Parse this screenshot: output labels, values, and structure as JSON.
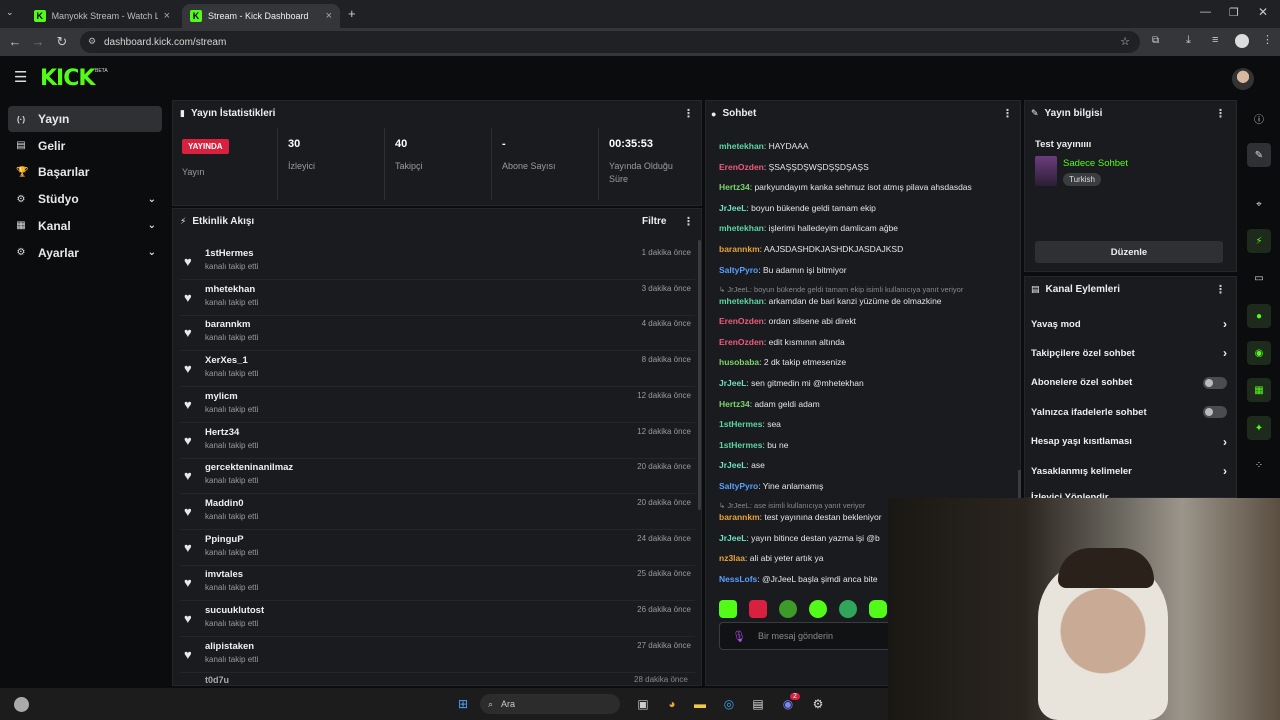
{
  "browser": {
    "tabs": [
      {
        "title": "Manyokk Stream - Watch Live o",
        "active": false
      },
      {
        "title": "Stream - Kick Dashboard",
        "active": true
      }
    ],
    "url": "dashboard.kick.com/stream"
  },
  "app": {
    "logo": "KICK",
    "beta": "BETA",
    "accent": "#53fc18"
  },
  "sidebar": {
    "items": [
      {
        "label": "Yayın",
        "icon": "broadcast-icon",
        "active": true,
        "expandable": false
      },
      {
        "label": "Gelir",
        "icon": "revenue-icon",
        "active": false,
        "expandable": false
      },
      {
        "label": "Başarılar",
        "icon": "trophy-icon",
        "active": false,
        "expandable": false
      },
      {
        "label": "Stüdyo",
        "icon": "studio-icon",
        "active": false,
        "expandable": true
      },
      {
        "label": "Kanal",
        "icon": "channel-icon",
        "active": false,
        "expandable": true
      },
      {
        "label": "Ayarlar",
        "icon": "gear-icon",
        "active": false,
        "expandable": true
      }
    ]
  },
  "stats": {
    "title": "Yayın İstatistikleri",
    "live_badge": "YAYINDA",
    "live_label": "Yayın",
    "cols": [
      {
        "value": "30",
        "label": "İzleyici"
      },
      {
        "value": "40",
        "label": "Takipçi"
      },
      {
        "value": "-",
        "label": "Abone Sayısı"
      },
      {
        "value": "00:35:53",
        "label": "Yayında Olduğu Süre"
      }
    ]
  },
  "activity": {
    "title": "Etkinlik Akışı",
    "filter": "Filtre",
    "items": [
      {
        "user": "1stHermes",
        "sub": "kanalı takip etti",
        "time": "1 dakika önce"
      },
      {
        "user": "mhetekhan",
        "sub": "kanalı takip etti",
        "time": "3 dakika önce"
      },
      {
        "user": "barannkm",
        "sub": "kanalı takip etti",
        "time": "4 dakika önce"
      },
      {
        "user": "XerXes_1",
        "sub": "kanalı takip etti",
        "time": "8 dakika önce"
      },
      {
        "user": "mylicm",
        "sub": "kanalı takip etti",
        "time": "12 dakika önce"
      },
      {
        "user": "Hertz34",
        "sub": "kanalı takip etti",
        "time": "12 dakika önce"
      },
      {
        "user": "gercekteninanilmaz",
        "sub": "kanalı takip etti",
        "time": "20 dakika önce"
      },
      {
        "user": "Maddin0",
        "sub": "kanalı takip etti",
        "time": "20 dakika önce"
      },
      {
        "user": "PpinguP",
        "sub": "kanalı takip etti",
        "time": "24 dakika önce"
      },
      {
        "user": "imvtales",
        "sub": "kanalı takip etti",
        "time": "25 dakika önce"
      },
      {
        "user": "sucuuklutost",
        "sub": "kanalı takip etti",
        "time": "26 dakika önce"
      },
      {
        "user": "alipistaken",
        "sub": "kanalı takip etti",
        "time": "27 dakika önce"
      }
    ]
  },
  "chat": {
    "title": "Sohbet",
    "messages": [
      {
        "type": "msg",
        "user": "mhetekhan",
        "color": "#5cd6a3",
        "text": ": HAYDAAA"
      },
      {
        "type": "msg",
        "user": "ErenOzden",
        "color": "#ef5c7a",
        "text": ": ŞSAŞŞDŞWŞDŞŞDŞAŞS"
      },
      {
        "type": "msg",
        "user": "Hertz34",
        "color": "#7bd66b",
        "text": ": parkyundayım kanka sehmuz isot atmış pilava ahsdasdas"
      },
      {
        "type": "msg",
        "user": "JrJeeL",
        "color": "#70e0c2",
        "text": ": boyun bükende geldi tamam ekip"
      },
      {
        "type": "msg",
        "user": "mhetekhan",
        "color": "#5cd6a3",
        "text": ": işlerimi halledeyim damlicam ağbe"
      },
      {
        "type": "msg",
        "user": "barannkm",
        "color": "#e8a23a",
        "text": ": AAJSDASHDKJASHDKJASDAJKSD"
      },
      {
        "type": "msg",
        "user": "SaltyPyro",
        "color": "#5aa0ff",
        "text": ": Bu adamın işi bitmiyor"
      },
      {
        "type": "reply",
        "text": "↳ JrJeeL: boyun bükende geldi tamam ekip isimli kullanıcıya yanıt veriyor"
      },
      {
        "type": "msg",
        "user": "mhetekhan",
        "color": "#5cd6a3",
        "text": ": arkamdan de bari kanzi yüzüme de olmazkine"
      },
      {
        "type": "msg",
        "user": "ErenOzden",
        "color": "#ef5c7a",
        "text": ": ordan silsene abi direkt"
      },
      {
        "type": "msg",
        "user": "ErenOzden",
        "color": "#ef5c7a",
        "text": ": edit kısmının altında"
      },
      {
        "type": "msg",
        "user": "husobaba",
        "color": "#7bd66b",
        "text": ": 2 dk takip etmesenize"
      },
      {
        "type": "msg",
        "user": "JrJeeL",
        "color": "#70e0c2",
        "text": ": sen gitmedin mi @mhetekhan"
      },
      {
        "type": "msg",
        "user": "Hertz34",
        "color": "#7bd66b",
        "text": ": adam geldi adam"
      },
      {
        "type": "msg",
        "user": "1stHermes",
        "color": "#5cd6a3",
        "text": ": sea"
      },
      {
        "type": "msg",
        "user": "1stHermes",
        "color": "#5cd6a3",
        "text": ": bu ne"
      },
      {
        "type": "msg",
        "user": "JrJeeL",
        "color": "#70e0c2",
        "text": ": ase"
      },
      {
        "type": "msg",
        "user": "SaltyPyro",
        "color": "#5aa0ff",
        "text": ": Yine anlamamış"
      },
      {
        "type": "reply",
        "text": "↳ JrJeeL: ase isimli kullanıcıya yanıt veriyor"
      },
      {
        "type": "msg",
        "user": "barannkm",
        "color": "#e8a23a",
        "text": ": test yayınına destan bekleniyor"
      },
      {
        "type": "msg",
        "user": "JrJeeL",
        "color": "#70e0c2",
        "text": ": yayın bitince destan yazma işi @b"
      },
      {
        "type": "msg",
        "user": "nz3laa",
        "color": "#e8a23a",
        "text": ": ali abi yeter artık ya"
      },
      {
        "type": "msg",
        "user": "NessLofs",
        "color": "#5aa0ff",
        "text": ": @JrJeeL başla şimdi anca bite"
      }
    ],
    "input_placeholder": "Bir mesaj gönderin"
  },
  "stream_info": {
    "title": "Yayın bilgisi",
    "stream_title": "Test yayınıııı",
    "category": "Sadece Sohbet",
    "tag": "Turkish",
    "edit_button": "Düzenle"
  },
  "channel_actions": {
    "title": "Kanal Eylemleri",
    "items": [
      {
        "label": "Yavaş mod",
        "kind": "chevron"
      },
      {
        "label": "Takipçilere özel sohbet",
        "kind": "chevron"
      },
      {
        "label": "Abonelere özel sohbet",
        "kind": "toggle"
      },
      {
        "label": "Yalnızca ifadelerle sohbet",
        "kind": "toggle"
      },
      {
        "label": "Hesap yaşı kısıtlaması",
        "kind": "chevron"
      },
      {
        "label": "Yasaklanmış kelimeler",
        "kind": "chevron"
      },
      {
        "label": "İzleyici Yönlendir",
        "kind": "none"
      }
    ]
  },
  "taskbar": {
    "search_label": "Ara",
    "badge": "2"
  }
}
